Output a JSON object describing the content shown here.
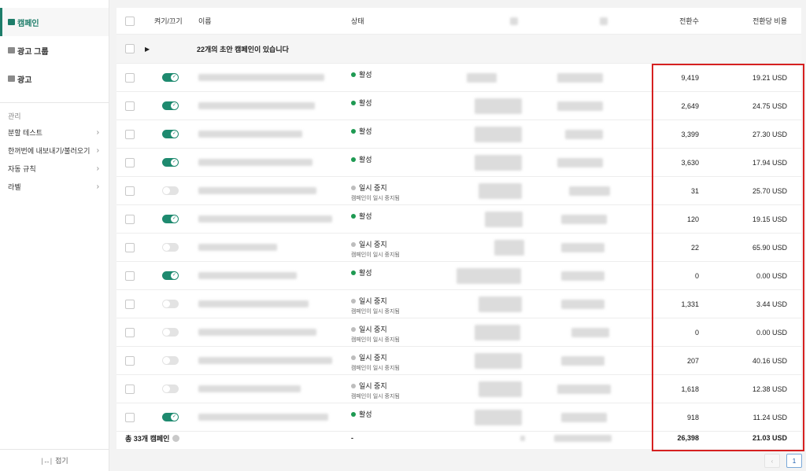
{
  "sidebar": {
    "nav": [
      {
        "label": "캠페인",
        "icon": "folder-icon",
        "active": true
      },
      {
        "label": "광고 그룹",
        "icon": "ad-group-icon",
        "active": false
      },
      {
        "label": "광고",
        "icon": "ad-icon",
        "active": false
      }
    ],
    "section_title": "관리",
    "sub_items": [
      {
        "label": "분할 테스트"
      },
      {
        "label": "한꺼번에 내보내기/불러오기"
      },
      {
        "label": "자동 규칙"
      },
      {
        "label": "라벨"
      }
    ],
    "collapse_label": "접기",
    "collapse_icon": "|↔|"
  },
  "table": {
    "headers": {
      "toggle": "켜기/끄기",
      "name": "이름",
      "status": "상태",
      "conversions": "전환수",
      "cost_per_conversion": "전환당 비용"
    },
    "draft_text": "22개의 초안 캠페인이 있습니다",
    "rows": [
      {
        "on": true,
        "status": "활성",
        "status_sub": "",
        "conversions": "9,419",
        "cpc": "19.21 USD"
      },
      {
        "on": true,
        "status": "활성",
        "status_sub": "",
        "conversions": "2,649",
        "cpc": "24.75 USD"
      },
      {
        "on": true,
        "status": "활성",
        "status_sub": "",
        "conversions": "3,399",
        "cpc": "27.30 USD"
      },
      {
        "on": true,
        "status": "활성",
        "status_sub": "",
        "conversions": "3,630",
        "cpc": "17.94 USD"
      },
      {
        "on": false,
        "status": "일시 중지",
        "status_sub": "캠페인이 일시 중지됨",
        "conversions": "31",
        "cpc": "25.70 USD"
      },
      {
        "on": true,
        "status": "활성",
        "status_sub": "",
        "conversions": "120",
        "cpc": "19.15 USD"
      },
      {
        "on": false,
        "status": "일시 중지",
        "status_sub": "캠페인이 일시 중지됨",
        "conversions": "22",
        "cpc": "65.90 USD"
      },
      {
        "on": true,
        "status": "활성",
        "status_sub": "",
        "conversions": "0",
        "cpc": "0.00 USD"
      },
      {
        "on": false,
        "status": "일시 중지",
        "status_sub": "캠페인이 일시 중지됨",
        "conversions": "1,331",
        "cpc": "3.44 USD"
      },
      {
        "on": false,
        "status": "일시 중지",
        "status_sub": "캠페인이 일시 중지됨",
        "conversions": "0",
        "cpc": "0.00 USD"
      },
      {
        "on": false,
        "status": "일시 중지",
        "status_sub": "캠페인이 일시 중지됨",
        "conversions": "207",
        "cpc": "40.16 USD"
      },
      {
        "on": false,
        "status": "일시 중지",
        "status_sub": "캠페인이 일시 중지됨",
        "conversions": "1,618",
        "cpc": "12.38 USD"
      },
      {
        "on": true,
        "status": "활성",
        "status_sub": "",
        "conversions": "918",
        "cpc": "11.24 USD"
      }
    ],
    "total": {
      "label": "총 33개 캠페인",
      "status": "-",
      "conversions": "26,398",
      "cpc": "21.03 USD"
    }
  },
  "pagination": {
    "prev": "‹",
    "current": "1"
  },
  "colors": {
    "accent": "#1e8a6f",
    "highlight_border": "#d62020",
    "active_dot": "#1e9a52",
    "paused_dot": "#bdbdbd"
  }
}
